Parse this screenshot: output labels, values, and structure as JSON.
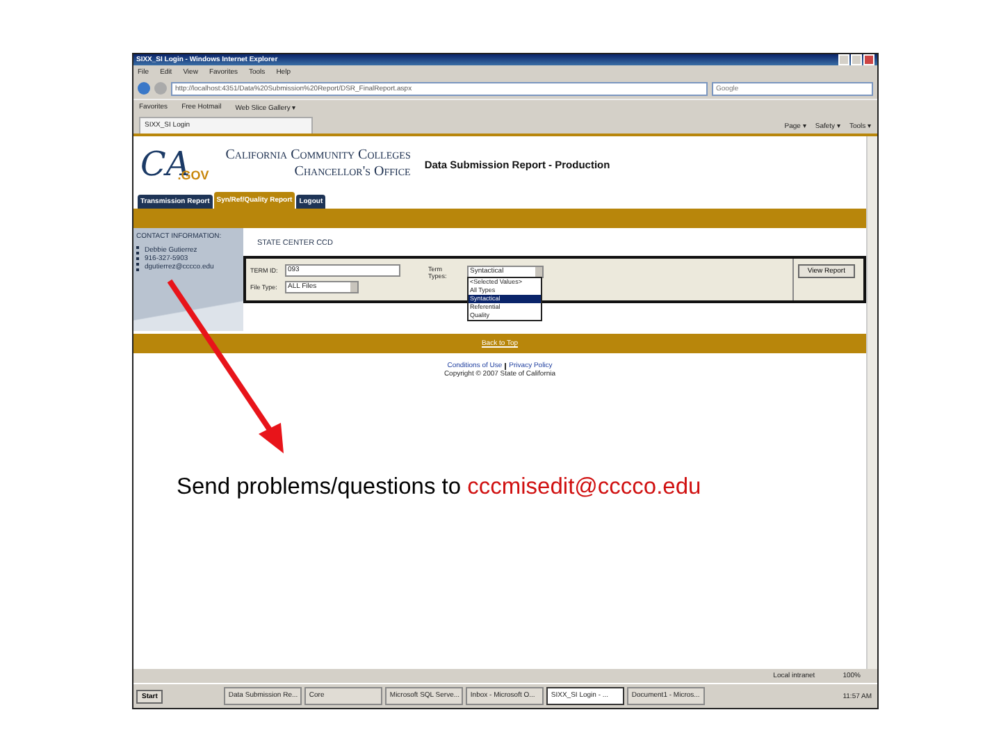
{
  "window": {
    "title": "SIXX_SI Login - Windows Internet Explorer"
  },
  "menu": [
    "File",
    "Edit",
    "View",
    "Favorites",
    "Tools",
    "Help"
  ],
  "address": "http://localhost:4351/Data%20Submission%20Report/DSR_FinalReport.aspx",
  "search": {
    "placeholder": "Google"
  },
  "favorites_bar": [
    "Favorites",
    "Free Hotmail",
    "Web Slice Gallery ▾"
  ],
  "browser_tab": "SIXX_SI Login",
  "command_bar": [
    "Page ▾",
    "Safety ▾",
    "Tools ▾"
  ],
  "header": {
    "logo_ca": "CA",
    "logo_gov": ".GOV",
    "org_line1": "California Community Colleges",
    "org_line2": "Chancellor's Office",
    "title": "Data Submission Report - Production"
  },
  "tabs": [
    {
      "label": "Transmission Report",
      "selected": false
    },
    {
      "label": "Syn/Ref/Quality Report",
      "selected": true
    },
    {
      "label": "Logout",
      "selected": false
    }
  ],
  "sidebar": {
    "heading": "CONTACT INFORMATION:",
    "name": "Debbie Gutierrez",
    "phone": "916-327-5903",
    "email": "dgutierrez@cccco.edu"
  },
  "district": "STATE CENTER CCD",
  "form": {
    "term_label": "TERM ID:",
    "term_value": "093",
    "file_type_label": "File Type:",
    "file_type_value": "ALL Files",
    "term_types_label": "Term Types:",
    "term_types_value": "Syntactical",
    "options": [
      {
        "label": "<Selected Values>",
        "selected": false
      },
      {
        "label": "All Types",
        "selected": false
      },
      {
        "label": "Syntactical",
        "selected": true
      },
      {
        "label": "Referential",
        "selected": false
      },
      {
        "label": "Quality",
        "selected": false
      }
    ],
    "button": "View Report"
  },
  "back_to_top": "Back to Top",
  "footer": {
    "links": [
      "Conditions of Use",
      "Privacy Policy"
    ],
    "copyright": "Copyright © 2007 State of California"
  },
  "status_bar": {
    "zone": "Local intranet",
    "zoom": "100%"
  },
  "taskbar": {
    "start": "Start",
    "items": [
      {
        "label": "Data Submission Re...",
        "selected": false
      },
      {
        "label": "Core",
        "selected": false
      },
      {
        "label": "Microsoft SQL Serve...",
        "selected": false
      },
      {
        "label": "Inbox - Microsoft O...",
        "selected": false
      },
      {
        "label": "SIXX_SI Login - ...",
        "selected": true
      },
      {
        "label": "Document1 - Micros...",
        "selected": false
      }
    ],
    "clock": "11:57 AM"
  },
  "annotation": {
    "text": "Send problems/questions to ",
    "email": "cccmisedit@cccco.edu"
  }
}
